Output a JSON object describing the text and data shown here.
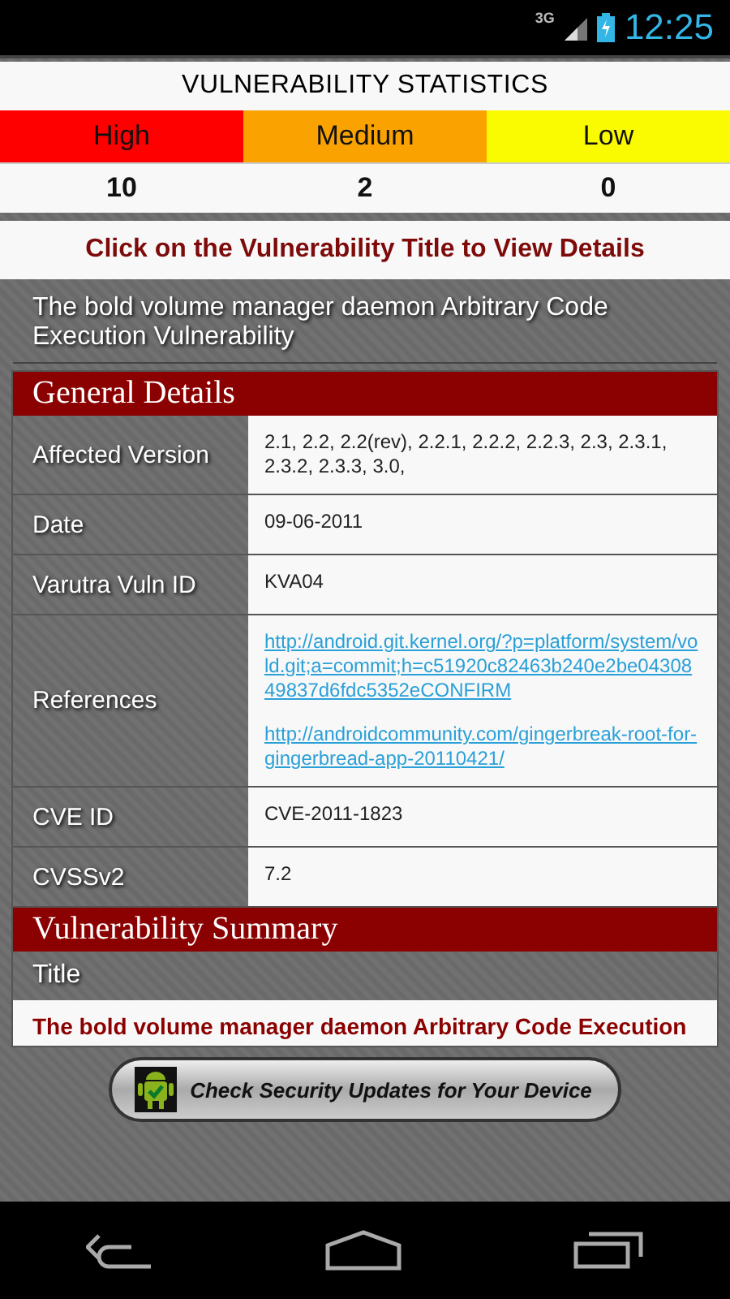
{
  "status_bar": {
    "network": "3G",
    "time": "12:25"
  },
  "statistics": {
    "title": "VULNERABILITY STATISTICS",
    "levels": [
      {
        "label": "High",
        "count": "10",
        "color": "#fe0000"
      },
      {
        "label": "Medium",
        "count": "2",
        "color": "#f9a200"
      },
      {
        "label": "Low",
        "count": "0",
        "color": "#fafa00"
      }
    ]
  },
  "instruction": "Click on the Vulnerability Title to View Details",
  "vulnerability_title": "The bold volume manager daemon Arbitrary Code Execution Vulnerability",
  "general_details": {
    "heading": "General Details",
    "rows": [
      {
        "label": "Affected Version",
        "kind": "text",
        "values": [
          "2.1, 2.2, 2.2(rev), 2.2.1, 2.2.2, 2.2.3, 2.3, 2.3.1, 2.3.2, 2.3.3, 3.0,"
        ]
      },
      {
        "label": "Date",
        "kind": "text",
        "values": [
          "09-06-2011"
        ]
      },
      {
        "label": "Varutra Vuln ID",
        "kind": "text",
        "values": [
          "KVA04"
        ]
      },
      {
        "label": "References",
        "kind": "links",
        "values": [
          "http://android.git.kernel.org/?p=platform/system/vold.git;a=commit;h=c51920c82463b240e2be0430849837d6fdc5352eCONFIRM",
          "http://androidcommunity.com/gingerbreak-root-for-gingerbread-app-20110421/"
        ]
      },
      {
        "label": "CVE ID",
        "kind": "text",
        "values": [
          "CVE-2011-1823"
        ]
      },
      {
        "label": "CVSSv2",
        "kind": "text",
        "values": [
          "7.2"
        ]
      }
    ]
  },
  "vulnerability_summary": {
    "heading": "Vulnerability Summary",
    "label": "Title",
    "value": "The bold volume manager daemon Arbitrary Code Execution"
  },
  "update_button": "Check Security Updates for Your Device"
}
